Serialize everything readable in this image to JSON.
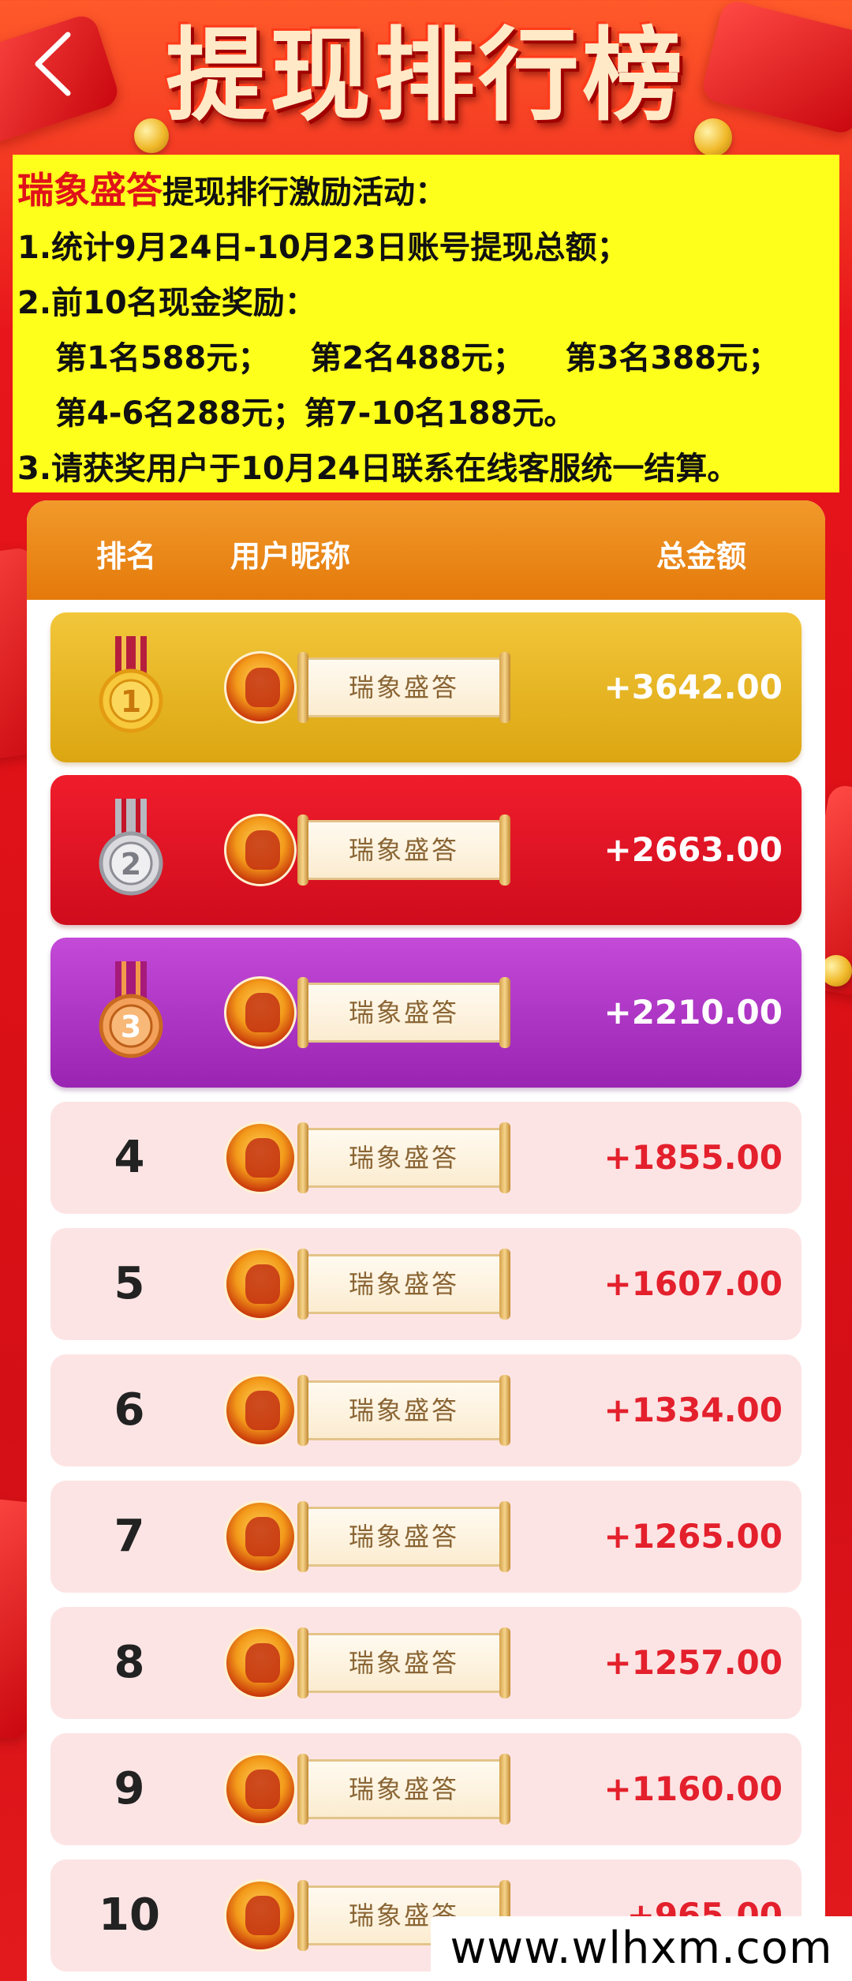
{
  "header": {
    "title": "提现排行榜"
  },
  "notice": {
    "brand": "瑞象盛答",
    "headline": "提现排行激励活动：",
    "line1": "1.统计9月24日-10月23日账号提现总额；",
    "line2": "2.前10名现金奖励：",
    "prize1": "第1名588元；",
    "prize2": "第2名488元；",
    "prize3": "第3名388元；",
    "prize4": "第4-6名288元；",
    "prize5": "第7-10名188元。",
    "line3": "3.请获奖用户于10月24日联系在线客服统一结算。"
  },
  "board": {
    "col_rank": "排名",
    "col_name": "用户昵称",
    "col_total": "总金额",
    "rows": [
      {
        "rank": "1",
        "nickname": "瑞象盛答",
        "amount": "+3642.00"
      },
      {
        "rank": "2",
        "nickname": "瑞象盛答",
        "amount": "+2663.00"
      },
      {
        "rank": "3",
        "nickname": "瑞象盛答",
        "amount": "+2210.00"
      },
      {
        "rank": "4",
        "nickname": "瑞象盛答",
        "amount": "+1855.00"
      },
      {
        "rank": "5",
        "nickname": "瑞象盛答",
        "amount": "+1607.00"
      },
      {
        "rank": "6",
        "nickname": "瑞象盛答",
        "amount": "+1334.00"
      },
      {
        "rank": "7",
        "nickname": "瑞象盛答",
        "amount": "+1265.00"
      },
      {
        "rank": "8",
        "nickname": "瑞象盛答",
        "amount": "+1257.00"
      },
      {
        "rank": "9",
        "nickname": "瑞象盛答",
        "amount": "+1160.00"
      },
      {
        "rank": "10",
        "nickname": "瑞象盛答",
        "amount": "+965.00"
      }
    ]
  },
  "watermark": "www.wlhxm.com",
  "colors": {
    "gold_row": "#dca611",
    "silver_row": "#cf0c1d",
    "bronze_row": "#9a24b2",
    "other_row": "#fde4e4",
    "amount_red": "#e3202c",
    "notice_bg": "#ffff1c"
  }
}
